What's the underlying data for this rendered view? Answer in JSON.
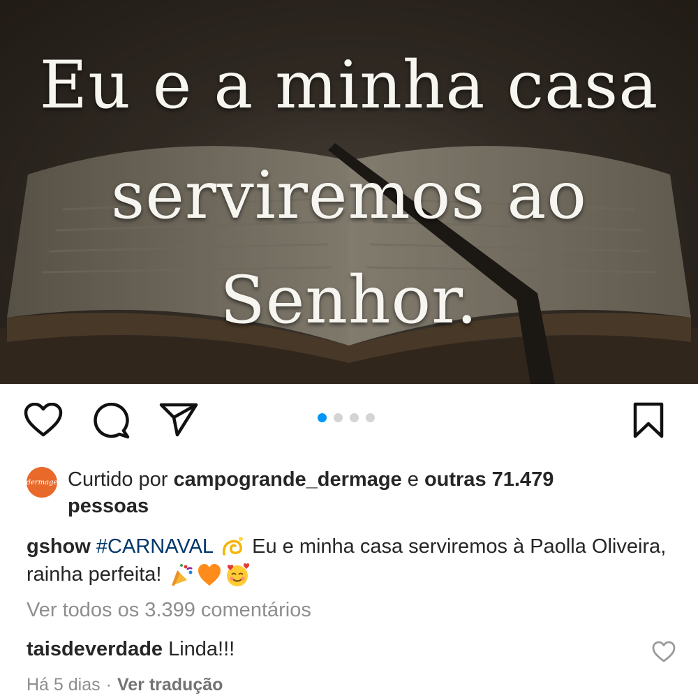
{
  "post_image": {
    "quote_line_1": "Eu e a minha casa",
    "quote_line_2": "serviremos ao",
    "quote_line_3": "Senhor."
  },
  "actions": {
    "like_icon": "heart-outline-icon",
    "comment_icon": "comment-bubble-icon",
    "share_icon": "paper-plane-icon",
    "save_icon": "bookmark-icon",
    "carousel_total": 4,
    "carousel_active": 1,
    "accent_color": "#0095f6"
  },
  "likes": {
    "avatar_text": "dermage",
    "prefix": "Curtido por ",
    "user": "campogrande_dermage",
    "middle": " e ",
    "others": "outras 71.479",
    "others_line2": "pessoas"
  },
  "caption": {
    "username": "gshow",
    "hashtag": "#CARNAVAL",
    "text": " Eu e minha casa serviremos à Paolla Oliveira, rainha perfeita! ",
    "emojis": [
      "dizzy-icon",
      "party-popper-icon",
      "orange-heart-icon",
      "smiling-face-hearts-icon"
    ],
    "hashtag_color": "#00376b"
  },
  "comments": {
    "view_all": "Ver todos os 3.399 comentários",
    "first": {
      "username": "taisdeverdade",
      "text": " Linda!!!",
      "time": "Há 5 dias",
      "separator": "·",
      "translate": "Ver tradução"
    }
  }
}
